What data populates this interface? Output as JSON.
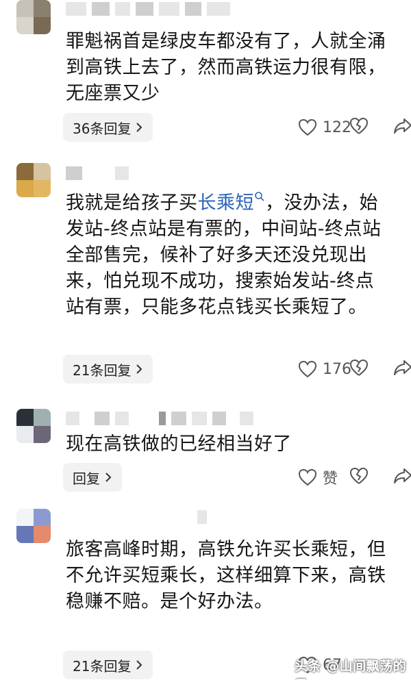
{
  "comments": [
    {
      "text": "罪魁祸首是绿皮车都没有了，人就全涌到高铁上去了，然而高铁运力很有限，无座票又少",
      "reply_label": "36条回复",
      "like_count": "122"
    },
    {
      "text_before": "我就是给孩子买",
      "link": "长乘短",
      "text_after": "，没办法，始发站-终点站是有票的，中间站-终点站全部售完，候补了好多天还没兑现出来，怕兑现不成功，搜索始发站-终点站有票，只能多花点钱买长乘短了。",
      "reply_label": "21条回复",
      "like_count": "176"
    },
    {
      "text": "现在高铁做的已经相当好了",
      "reply_label": "回复",
      "like_count": "赞"
    },
    {
      "text": "旅客高峰时期，高铁允许买长乘短，但不允许买短乘长，这样细算下来，高铁稳赚不赔。是个好办法。",
      "reply_label": "21条回复",
      "like_count": "67"
    }
  ],
  "watermark": "头条 @山间飘荡的云",
  "colors": {
    "link": "#2c63b8",
    "reply_bg": "#f2f2f2",
    "icon": "#555555"
  }
}
